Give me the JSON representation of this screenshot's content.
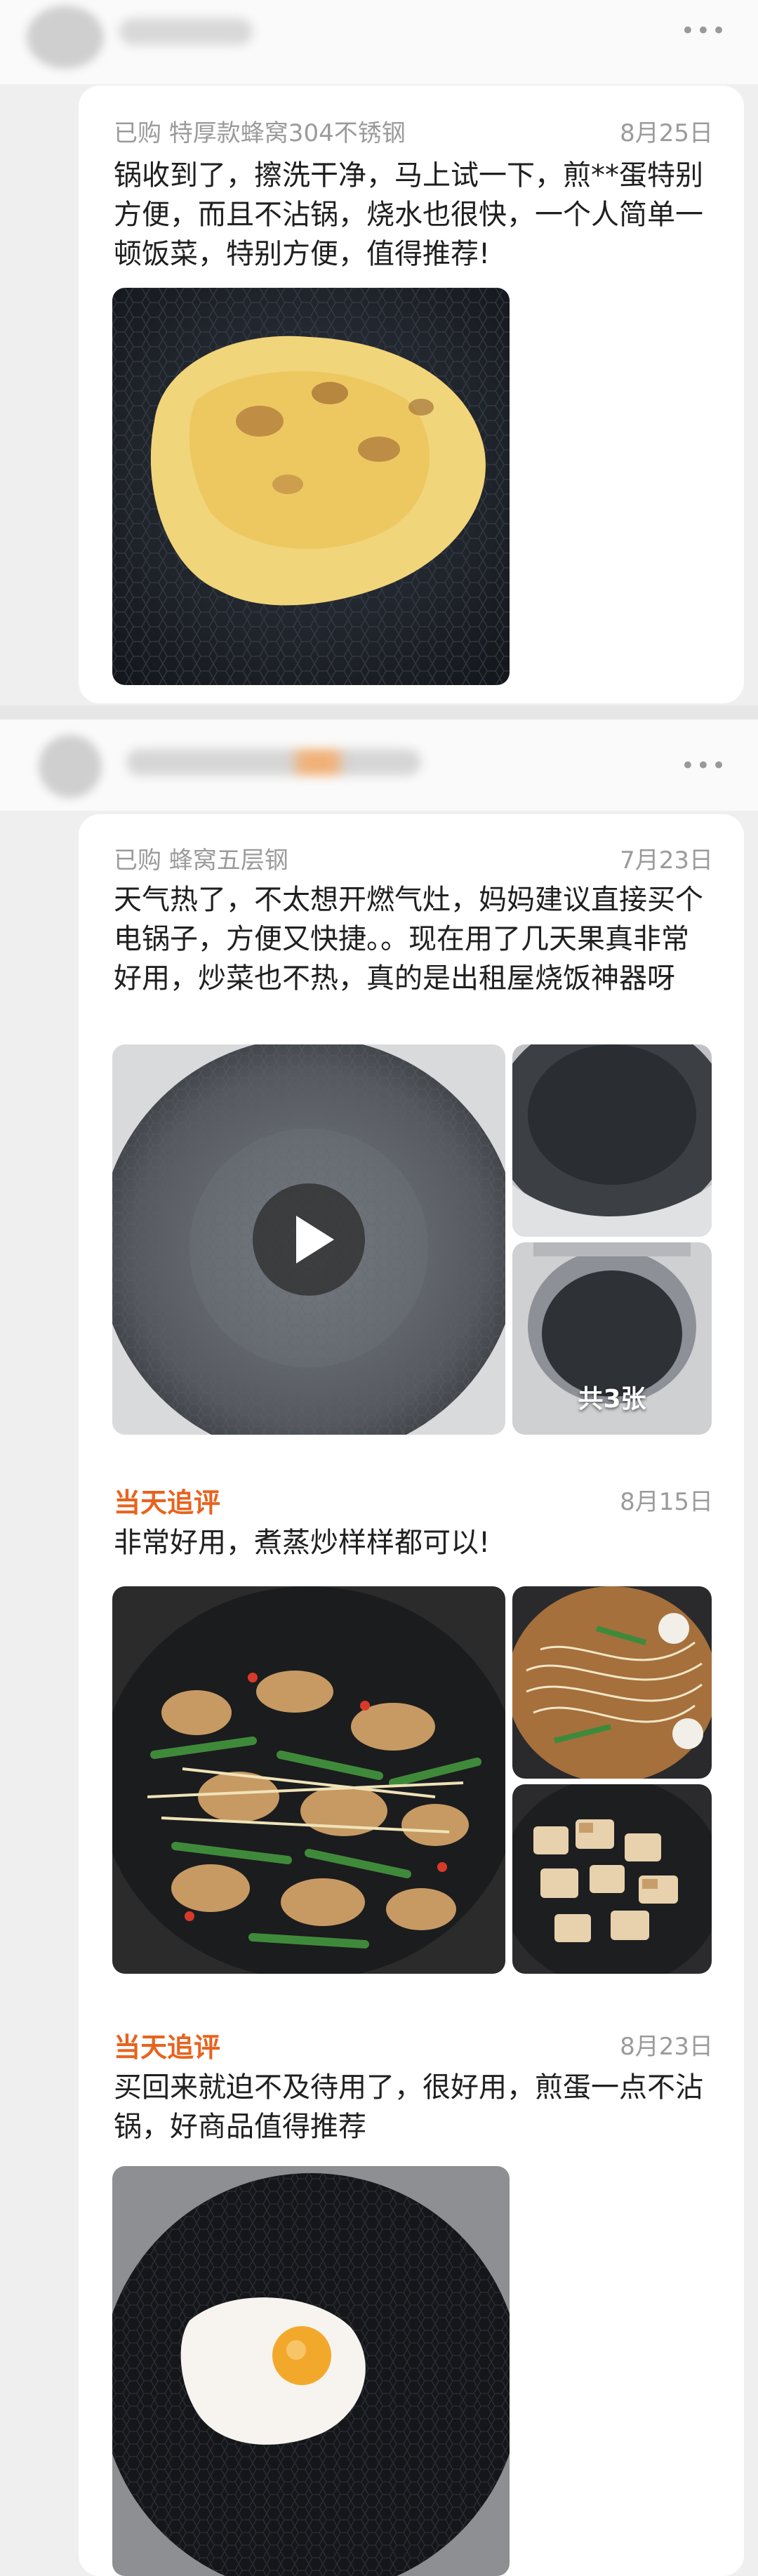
{
  "icons": {
    "more": "more-horizontal-icon",
    "play": "play-icon"
  },
  "colors": {
    "followup_accent": "#e8631f",
    "meta_gray": "#9b9b9b",
    "card_bg": "#ffffff"
  },
  "reviews": [
    {
      "more_label": "•••",
      "meta": "已购 特厚款蜂窝304不锈钢",
      "date": "8月25日",
      "text": "锅收到了，擦洗干净，马上试一下，煎**蛋特别方便，而且不沾锅，烧水也很快，一个人简单一顿饭菜，特别方便，值得推荐!"
    },
    {
      "more_label": "•••",
      "meta": "已购 蜂窝五层钢",
      "date": "7月23日",
      "text": "天气热了，不太想开燃气灶，妈妈建议直接买个电锅子，方便又快捷。。现在用了几天果真非常好用，炒菜也不热，真的是出租屋烧饭神器呀",
      "photo_count": "共3张",
      "followups": [
        {
          "label": "当天追评",
          "date": "8月15日",
          "text": "非常好用，煮蒸炒样样都可以!"
        },
        {
          "label": "当天追评",
          "date": "8月23日",
          "text": "买回来就迫不及待用了，很好用，煎蛋一点不沾锅，好商品值得推荐"
        }
      ]
    }
  ]
}
